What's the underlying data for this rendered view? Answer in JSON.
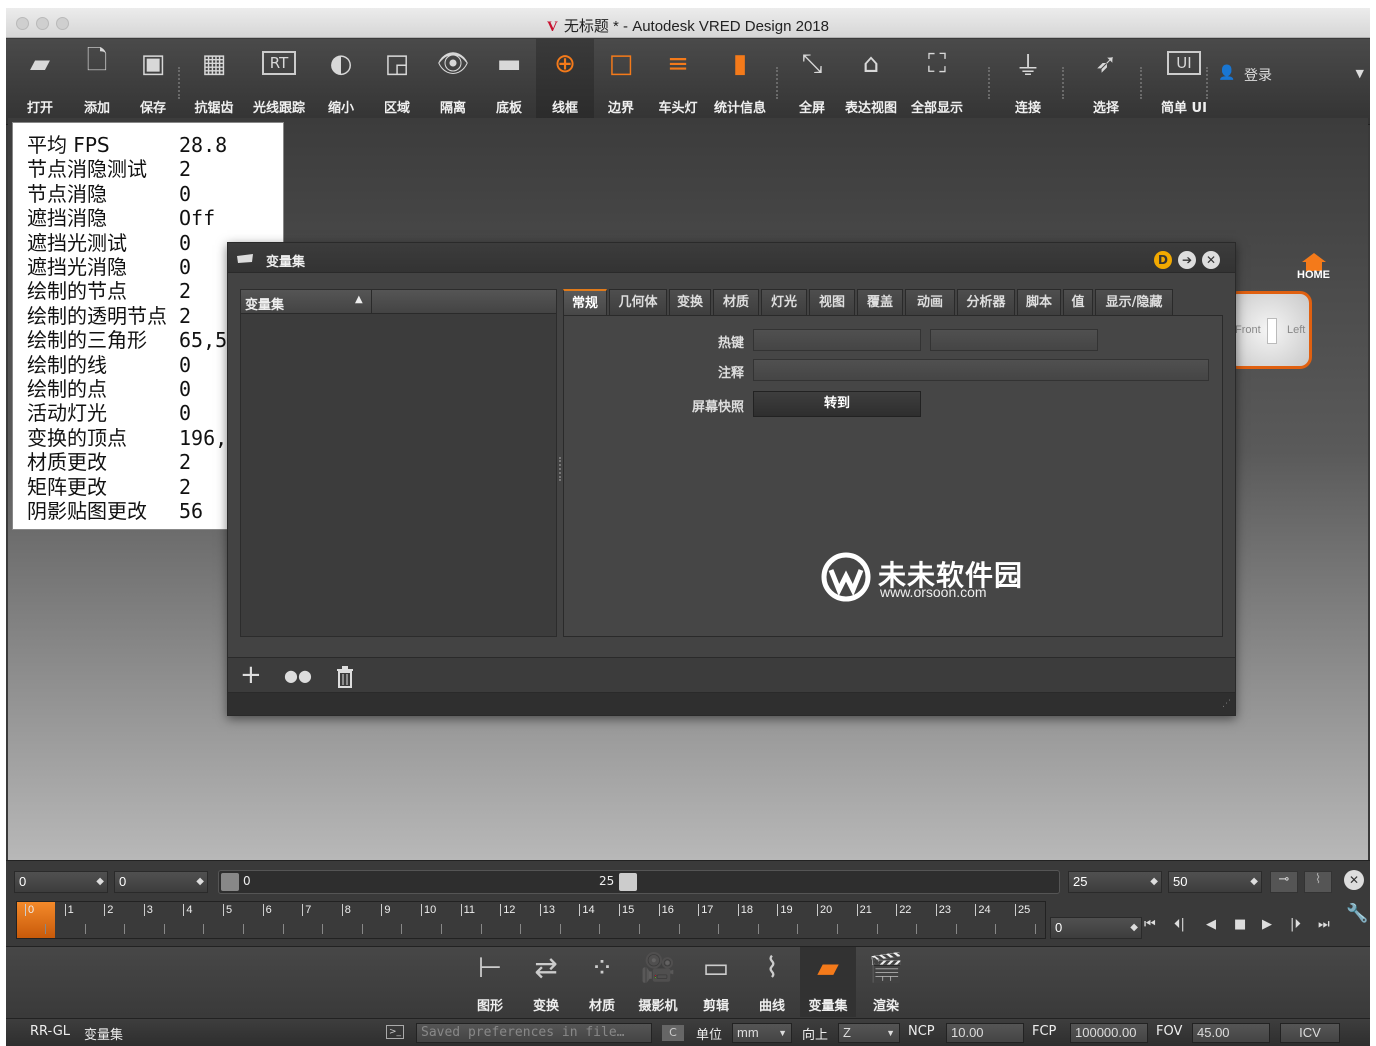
{
  "window": {
    "title": "无标题 * - Autodesk VRED Design 2018",
    "logo_letter": "V"
  },
  "toolbar": {
    "items": [
      {
        "label": "打开",
        "icon": "folder-open-icon",
        "glyph": "▰"
      },
      {
        "label": "添加",
        "icon": "add-file-icon",
        "glyph": "🗋"
      },
      {
        "label": "保存",
        "icon": "save-disk-icon",
        "glyph": "▣"
      },
      {
        "label": "抗锯齿",
        "icon": "antialias-grid-icon",
        "glyph": "▦"
      },
      {
        "label": "光线跟踪",
        "icon": "raytrace-rt-icon",
        "glyph": "RT"
      },
      {
        "label": "缩小",
        "icon": "half-circle-icon",
        "glyph": "◐"
      },
      {
        "label": "区域",
        "icon": "region-window-icon",
        "glyph": "◲"
      },
      {
        "label": "隔离",
        "icon": "eye-isolate-icon",
        "glyph": "👁"
      },
      {
        "label": "底板",
        "icon": "backplate-monitor-icon",
        "glyph": "▬"
      },
      {
        "label": "线框",
        "icon": "wireframe-globe-icon",
        "glyph": "⊕"
      },
      {
        "label": "边界",
        "icon": "boundary-square-icon",
        "glyph": "□"
      },
      {
        "label": "车头灯",
        "icon": "headlight-icon",
        "glyph": "≡"
      },
      {
        "label": "统计信息",
        "icon": "statistics-bars-icon",
        "glyph": "▮"
      },
      {
        "label": "全屏",
        "icon": "fullscreen-arrows-icon",
        "glyph": "⤡"
      },
      {
        "label": "表达视图",
        "icon": "presentation-easel-icon",
        "glyph": "⌂"
      },
      {
        "label": "全部显示",
        "icon": "show-all-frame-icon",
        "glyph": "⛶"
      },
      {
        "label": "连接",
        "icon": "plug-connect-icon",
        "glyph": "⏚"
      },
      {
        "label": "选择",
        "icon": "select-pointer-icon",
        "glyph": "➶"
      },
      {
        "label": "简单 UI",
        "icon": "simple-ui-icon",
        "glyph": "UI"
      }
    ],
    "login_label": "登录"
  },
  "stats": [
    {
      "k": "平均 FPS",
      "v": "28.8"
    },
    {
      "k": "节点消隐测试",
      "v": "2"
    },
    {
      "k": "节点消隐",
      "v": "0"
    },
    {
      "k": "遮挡消隐",
      "v": "Off"
    },
    {
      "k": "遮挡光测试",
      "v": "0"
    },
    {
      "k": "遮挡光消隐",
      "v": "0"
    },
    {
      "k": "绘制的节点",
      "v": "2"
    },
    {
      "k": "绘制的透明节点",
      "v": "2"
    },
    {
      "k": "绘制的三角形",
      "v": "65,5"
    },
    {
      "k": "绘制的线",
      "v": "0"
    },
    {
      "k": "绘制的点",
      "v": "0"
    },
    {
      "k": "活动灯光",
      "v": "0"
    },
    {
      "k": "变换的顶点",
      "v": "196,"
    },
    {
      "k": "材质更改",
      "v": "2"
    },
    {
      "k": "矩阵更改",
      "v": "2"
    },
    {
      "k": "阴影贴图更改",
      "v": "56"
    }
  ],
  "navcube": {
    "home": "HOME",
    "front": "Front",
    "left": "Left"
  },
  "dialog": {
    "title": "变量集",
    "list_header": "变量集",
    "tabs": [
      "常规",
      "几何体",
      "变换",
      "材质",
      "灯光",
      "视图",
      "覆盖",
      "动画",
      "分析器",
      "脚本",
      "值",
      "显示/隐藏"
    ],
    "fields": {
      "hotkey": "热键",
      "comment": "注释",
      "screenshot": "屏幕快照",
      "goto": "转到"
    }
  },
  "watermark": {
    "cn": "未未软件园",
    "url": "www.orsoon.com"
  },
  "timeline": {
    "start": "0",
    "current": "0",
    "slider_min": "0",
    "slider_max": "25",
    "end_a": "25",
    "end_b": "50",
    "frame": "0",
    "ticks": [
      "0",
      "1",
      "2",
      "3",
      "4",
      "5",
      "6",
      "7",
      "8",
      "9",
      "10",
      "11",
      "12",
      "13",
      "14",
      "15",
      "16",
      "17",
      "18",
      "19",
      "20",
      "21",
      "22",
      "23",
      "24",
      "25"
    ]
  },
  "modules": [
    {
      "label": "图形",
      "icon": "scenegraph-icon",
      "glyph": "⊢"
    },
    {
      "label": "变换",
      "icon": "transform-icon",
      "glyph": "⇄"
    },
    {
      "label": "材质",
      "icon": "materials-icon",
      "glyph": "⁘"
    },
    {
      "label": "摄影机",
      "icon": "camera-icon",
      "glyph": "🎥"
    },
    {
      "label": "剪辑",
      "icon": "clip-film-icon",
      "glyph": "▭"
    },
    {
      "label": "曲线",
      "icon": "curves-icon",
      "glyph": "⌇"
    },
    {
      "label": "变量集",
      "icon": "variant-sets-icon",
      "glyph": "▰"
    },
    {
      "label": "渲染",
      "icon": "render-clapper-icon",
      "glyph": "🎬"
    }
  ],
  "status": {
    "renderer": "RR-GL",
    "module": "变量集",
    "message": "Saved preferences in file…",
    "unit_label": "单位",
    "unit": "mm",
    "up_label": "向上",
    "up": "Z",
    "ncp_label": "NCP",
    "ncp": "10.00",
    "fcp_label": "FCP",
    "fcp": "100000.00",
    "fov_label": "FOV",
    "fov": "45.00",
    "icv": "ICV"
  },
  "colors": {
    "accent": "#e07a1a",
    "orange": "#f47a1a"
  }
}
